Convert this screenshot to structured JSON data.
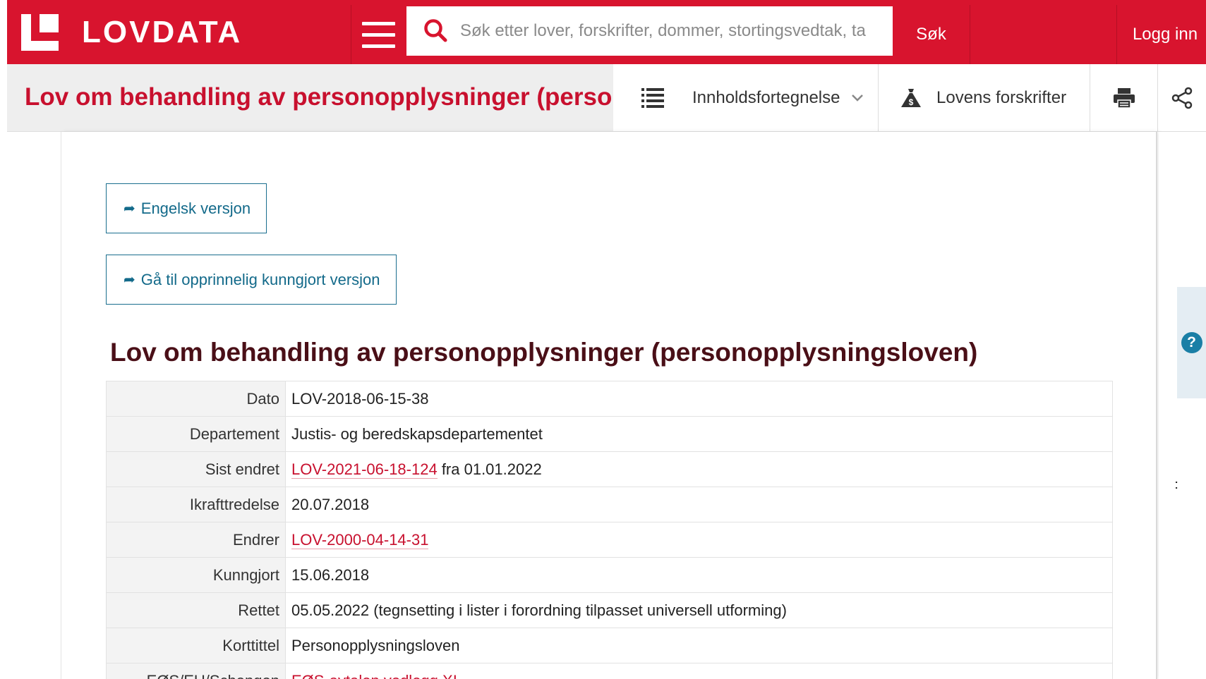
{
  "header": {
    "logo_text": "LOVDATA",
    "search_placeholder": "Søk etter lover, forskrifter, dommer, stortingsvedtak, ta",
    "search_button": "Søk",
    "login_button": "Logg inn"
  },
  "titlebar": {
    "title": "Lov om behandling av personopplysninger (personopplysningsloven)",
    "toc_label": "Innholdsfortegnelse",
    "regulations_label": "Lovens forskrifter"
  },
  "content": {
    "english_link": "Engelsk versjon",
    "original_link": "Gå til opprinnelig kunngjort versjon",
    "law_title": "Lov om behandling av personopplysninger (personopplysningsloven)",
    "meta": [
      {
        "key": "Dato",
        "value": "LOV-2018-06-15-38"
      },
      {
        "key": "Departement",
        "value": "Justis- og beredskapsdepartementet"
      },
      {
        "key": "Sist endret",
        "link": "LOV-2021-06-18-124",
        "suffix": " fra 01.01.2022"
      },
      {
        "key": "Ikrafttredelse",
        "value": "20.07.2018"
      },
      {
        "key": "Endrer",
        "link": "LOV-2000-04-14-31"
      },
      {
        "key": "Kunngjort",
        "value": "15.06.2018"
      },
      {
        "key": "Rettet",
        "value": "05.05.2022 (tegnsetting i lister i forordning tilpasset universell utforming)"
      },
      {
        "key": "Korttittel",
        "value": "Personopplysningsloven"
      },
      {
        "key": "EØS/EU/Schengen",
        "link": "EØS-avtalen vedlegg XI"
      }
    ]
  },
  "side": {
    "help_symbol": "?"
  },
  "colors": {
    "brand_red": "#d8142e",
    "title_red": "#c8102e",
    "law_title": "#4a0f17",
    "link_blue": "#136a8a"
  },
  "icons": [
    "search-icon",
    "menu-icon",
    "list-icon",
    "chevron-down-icon",
    "money-bag-icon",
    "printer-icon",
    "share-icon",
    "arrow-right-icon",
    "help-icon"
  ]
}
